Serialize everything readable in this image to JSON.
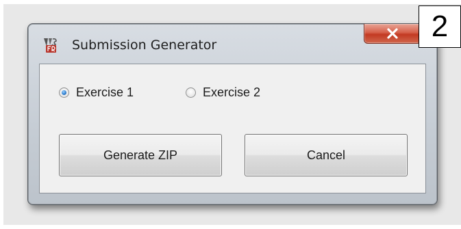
{
  "window": {
    "title": "Submission Generator",
    "app_icon": "app-logo-icon",
    "close_icon": "close-icon",
    "close_color": "#c33a22"
  },
  "options": [
    {
      "label": "Exercise 1",
      "checked": true
    },
    {
      "label": "Exercise 2",
      "checked": false
    }
  ],
  "buttons": {
    "generate_label": "Generate ZIP",
    "cancel_label": "Cancel"
  },
  "step_badge": "2"
}
